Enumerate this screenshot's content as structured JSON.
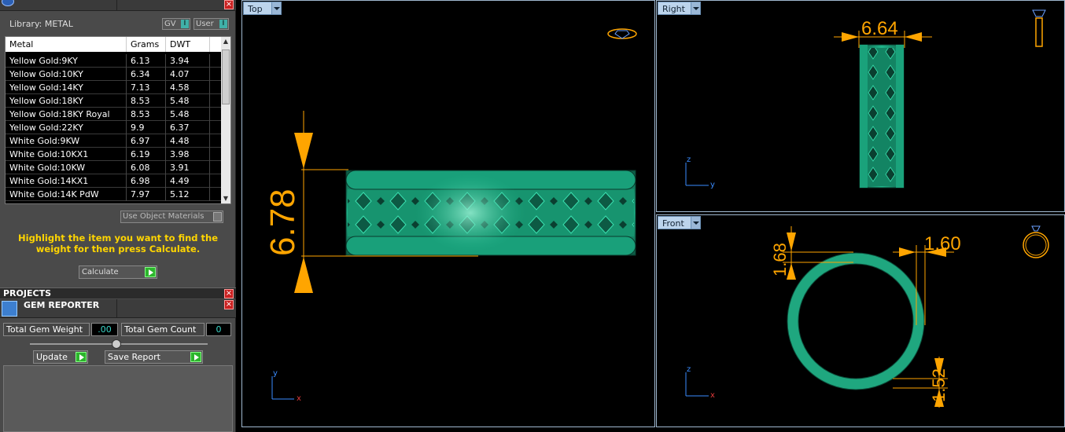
{
  "library": {
    "label": "Library: METAL",
    "toggle_gv": "GV",
    "toggle_user": "User",
    "columns": [
      "Metal",
      "Grams",
      "DWT"
    ],
    "rows": [
      [
        "Yellow Gold:9KY",
        "6.13",
        "3.94"
      ],
      [
        "Yellow Gold:10KY",
        "6.34",
        "4.07"
      ],
      [
        "Yellow Gold:14KY",
        "7.13",
        "4.58"
      ],
      [
        "Yellow Gold:18KY",
        "8.53",
        "5.48"
      ],
      [
        "Yellow Gold:18KY Royal",
        "8.53",
        "5.48"
      ],
      [
        "Yellow Gold:22KY",
        "9.9",
        "6.37"
      ],
      [
        "White Gold:9KW",
        "6.97",
        "4.48"
      ],
      [
        "White Gold:10KX1",
        "6.19",
        "3.98"
      ],
      [
        "White Gold:10KW",
        "6.08",
        "3.91"
      ],
      [
        "White Gold:14KX1",
        "6.98",
        "4.49"
      ],
      [
        "White Gold:14K PdW",
        "7.97",
        "5.12"
      ]
    ],
    "use_object_materials": "Use Object Materials",
    "hint": "Highlight the item you want to find the weight for then press Calculate.",
    "calculate": "Calculate"
  },
  "projects": {
    "title": "PROJECTS"
  },
  "gem_reporter": {
    "title": "GEM REPORTER",
    "total_weight_label": "Total Gem Weight",
    "total_weight_value": ".00",
    "total_count_label": "Total Gem Count",
    "total_count_value": "0",
    "update": "Update",
    "save_report": "Save Report"
  },
  "viewports": {
    "top": {
      "label": "Top",
      "dimension": "6.78",
      "axis_v": "y",
      "axis_h": "x"
    },
    "right": {
      "label": "Right",
      "dimension": "6.64",
      "axis_v": "z",
      "axis_h": "y"
    },
    "front": {
      "label": "Front",
      "dim_top_left": "1.68",
      "dim_top_right": "1.60",
      "dim_bottom_right": "1.52",
      "axis_v": "z",
      "axis_h": "x"
    }
  },
  "colors": {
    "ring": "#1fa77f",
    "dimension": "#ffa500",
    "hint": "#ffd500"
  }
}
